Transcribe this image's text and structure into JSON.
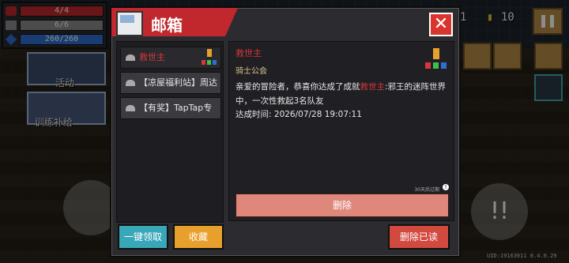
{
  "hud": {
    "hp": "4/4",
    "armor": "6/6",
    "energy": "260/260",
    "activity_label": "活动",
    "training_label": "训练补给",
    "gems": "1",
    "coins": "10",
    "uid": "UID:19163011 8.4.0.29"
  },
  "colors": {
    "hp": "#c0282d",
    "armor": "#8a8a8a",
    "energy": "#2f6fd0",
    "ribbon": "#c0282d",
    "accent_red": "#d9363b"
  },
  "mailbox": {
    "title": "邮箱",
    "close_icon": "x-icon",
    "mail_list": [
      {
        "label": "救世主",
        "active": true
      },
      {
        "label": "【凉屋福利站】周达",
        "active": false
      },
      {
        "label": "【有奖】TapTap专",
        "active": false
      }
    ],
    "detail": {
      "sender": "救世主",
      "org": "骑士公会",
      "body_pre": "亲爱的冒险者，恭喜你达成了成就",
      "body_hl": "救世主",
      "body_post": ":邪王的迷阵世界中，一次性救起3名队友",
      "time_label": "达成时间:",
      "time_value": "2026/07/28 19:07:11",
      "expire_text": "30天后过期",
      "delete_label": "删除"
    },
    "buttons": {
      "claim_all": "一键领取",
      "favorite": "收藏",
      "delete_read": "删除已读"
    }
  }
}
